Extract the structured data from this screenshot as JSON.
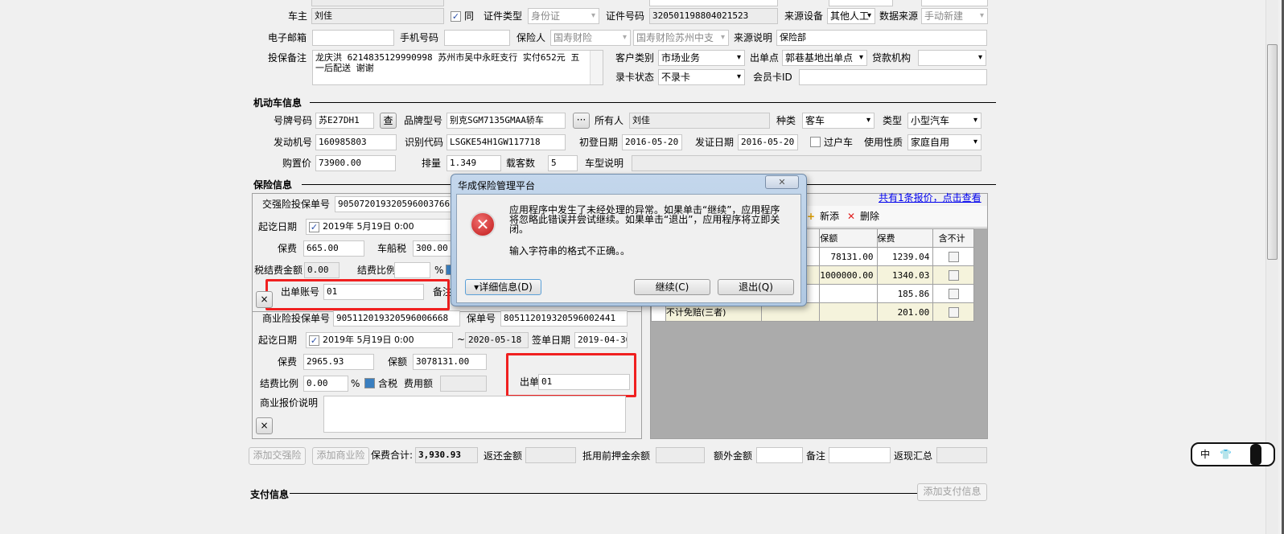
{
  "owner_section": {
    "owner_label": "车主",
    "owner_value": "刘佳",
    "same_checked": true,
    "same_label": "同",
    "id_type_label": "证件类型",
    "id_type_value": "身份证",
    "id_no_label": "证件号码",
    "id_no_value": "320501198804021523",
    "source_device_label": "来源设备",
    "source_device_value": "其他人工",
    "data_source_label": "数据来源",
    "data_source_value": "手动新建",
    "email_label": "电子邮箱",
    "email_value": "",
    "mobile_label": "手机号码",
    "mobile_value": "",
    "insurer_label": "保险人",
    "insurer_value": "国寿财险",
    "insurer_branch_value": "国寿财险苏州中支",
    "source_desc_label": "来源说明",
    "source_desc_value": "保险部",
    "remark_label": "投保备注",
    "remark_value": "龙庆洪 6214835129990998 苏州市吴中永旺支行 实付652元  五一后配送 谢谢",
    "customer_type_label": "客户类别",
    "customer_type_value": "市场业务",
    "issue_point_label": "出单点",
    "issue_point_value": "郭巷基地出单点",
    "loan_org_label": "贷款机构",
    "loan_org_value": "",
    "card_status_label": "录卡状态",
    "card_status_value": "不录卡",
    "member_card_label": "会员卡ID",
    "member_card_value": ""
  },
  "vehicle": {
    "title": "机动车信息",
    "plate_label": "号牌号码",
    "plate_value": "苏E27DH1",
    "lookup_button": "查",
    "brand_label": "品牌型号",
    "brand_value": "别克SGM7135GMAA轿车",
    "more_button": "···",
    "holder_label": "所有人",
    "holder_value": "刘佳",
    "kind_label": "种类",
    "kind_value": "客车",
    "type_label": "类型",
    "type_value": "小型汽车",
    "engine_label": "发动机号",
    "engine_value": "160985803",
    "vin_label": "识别代码",
    "vin_value": "LSGKE54H1GW117718",
    "reg_date_label": "初登日期",
    "reg_date_value": "2016-05-20",
    "cert_date_label": "发证日期",
    "cert_date_value": "2016-05-20",
    "transfer_label": "过户车",
    "transfer_checked": false,
    "usage_label": "使用性质",
    "usage_value": "家庭自用",
    "price_label": "购置价",
    "price_value": "73900.00",
    "displacement_label": "排量",
    "displacement_value": "1.349",
    "seats_label": "载客数",
    "seats_value": "5",
    "model_desc_label": "车型说明",
    "model_desc_value": ""
  },
  "insurance": {
    "title": "保险信息",
    "compulsory": {
      "proposal_label": "交强险投保单号",
      "proposal_value": "905072019320596003766",
      "period_label": "起讫日期",
      "period_value": "2019年 5月19日   0:00",
      "premium_label": "保费",
      "premium_value": "665.00",
      "vessel_tax_label": "车船税",
      "vessel_tax_value": "300.00",
      "tax_settle_label": "税结费金额",
      "tax_settle_value": "0.00",
      "settle_ratio_label": "结费比例",
      "settle_ratio_value": "",
      "percent": "%",
      "account_label": "出单账号",
      "account_value": "01",
      "note_label": "备注"
    },
    "commercial": {
      "proposal_label": "商业险投保单号",
      "proposal_value": "905112019320596006668",
      "policy_label": "保单号",
      "policy_value": "805112019320596002441",
      "period_label": "起讫日期",
      "period_value": "2019年 5月19日   0:00",
      "tilde": "~",
      "end_value": "2020-05-18",
      "sign_date_label": "签单日期",
      "sign_date_value": "2019-04-30",
      "premium_label": "保费",
      "premium_value": "2965.93",
      "amount_label": "保额",
      "amount_value": "3078131.00",
      "settle_ratio_label": "结费比例",
      "settle_ratio_value": "0.00",
      "percent": "%",
      "tax_incl_label": "含税",
      "fee_label": "费用额",
      "fee_value": "",
      "account_label": "出单账号",
      "account_value": "01",
      "quote_desc_label": "商业报价说明",
      "quote_desc_value": ""
    },
    "delete_icon": "×",
    "quote_link": "共有1条报价，点击查看",
    "add_label": "新添",
    "delete_label": "删除",
    "risk_table": {
      "headers": [
        "保额",
        "保费",
        "含不计"
      ],
      "rows": [
        {
          "name": "",
          "amount": "78131.00",
          "premium": "1239.04",
          "excl": false
        },
        {
          "name": "",
          "amount": "1000000.00",
          "premium": "1340.03",
          "excl": false
        },
        {
          "name": "",
          "amount": "",
          "premium": "185.86",
          "excl": false
        },
        {
          "name": "不计免赔(三者)",
          "amount": "",
          "premium": "201.00",
          "excl": false
        }
      ]
    }
  },
  "totals": {
    "add_compulsory": "添加交强险",
    "add_commercial": "添加商业险",
    "premium_total_label": "保费合计:",
    "premium_total_value": "3,930.93",
    "refund_label": "返还金额",
    "deposit_label": "抵用前押金余额",
    "extra_label": "额外金额",
    "note_label": "备注",
    "cashback_label": "返现汇总"
  },
  "payment": {
    "title": "支付信息",
    "add_button": "添加支付信息"
  },
  "dialog": {
    "title": "华成保险管理平台",
    "close": "✕",
    "message": "应用程序中发生了未经处理的异常。如果单击“继续”，应用程序将忽略此错误并尝试继续。如果单击“退出”，应用程序将立即关闭。",
    "detail": "输入字符串的格式不正确。。",
    "details_button": "▾详细信息(D)",
    "continue_button": "继续(C)",
    "quit_button": "退出(Q)"
  },
  "ime": {
    "label": "中"
  },
  "colors": {
    "highlight": "#f02020",
    "link": "#0000ee",
    "row_alt": "#f5f3dc",
    "grid_bg": "#ababab"
  }
}
